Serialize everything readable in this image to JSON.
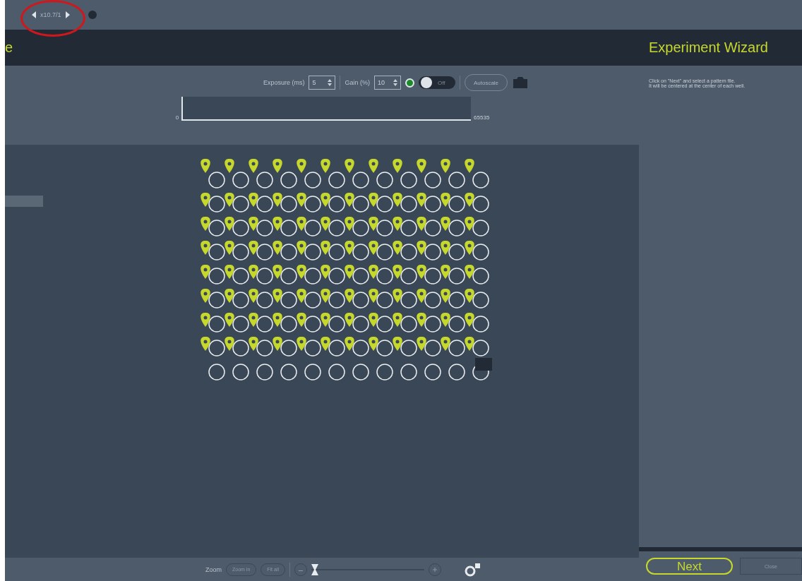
{
  "toolbar": {
    "counter": "x10.7/1"
  },
  "header": {
    "title_fragment": "e"
  },
  "camera": {
    "exposure_label": "Exposure (ms)",
    "exposure_value": "5",
    "gain_label": "Gain (%)",
    "gain_value": "10",
    "live": true,
    "toggle": {
      "label": "Off",
      "on": false
    },
    "autoscale": "Autoscale",
    "histogram": {
      "min": "0",
      "max": "65535"
    }
  },
  "wizard": {
    "title": "Experiment Wizard",
    "instructions": "Click on \"Next\" and select a pattern file.\nIt will be centered at the center of each well."
  },
  "bottom": {
    "zoom_label": "Zoom",
    "zoom_buttons": [
      "Zoom in",
      "Fit all"
    ],
    "zoom_slider": {
      "level": 0.0
    }
  },
  "buttons": {
    "next": "Next",
    "close": "Close"
  }
}
